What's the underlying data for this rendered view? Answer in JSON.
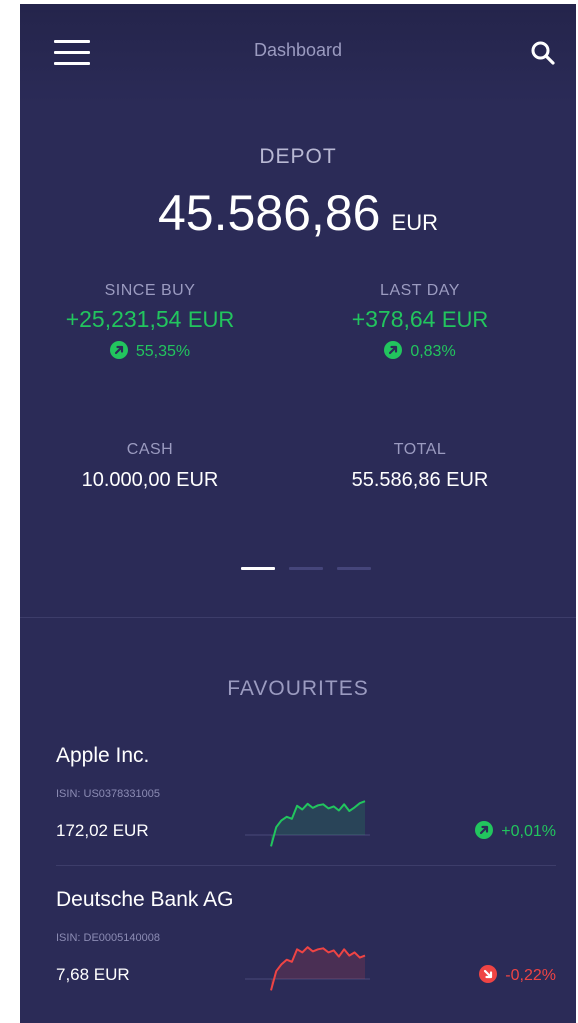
{
  "header": {
    "title": "Dashboard",
    "menu_icon": "hamburger-icon",
    "search_icon": "search-icon"
  },
  "depot": {
    "label": "DEPOT",
    "value": "45.586,86",
    "currency": "EUR"
  },
  "since_buy": {
    "label": "SINCE BUY",
    "value": "+25,231,54",
    "currency": "EUR",
    "percent": "55,35%",
    "direction": "up"
  },
  "last_day": {
    "label": "LAST DAY",
    "value": "+378,64",
    "currency": "EUR",
    "percent": "0,83%",
    "direction": "up"
  },
  "cash": {
    "label": "CASH",
    "value": "10.000,00 EUR"
  },
  "total": {
    "label": "TOTAL",
    "value": "55.586,86 EUR"
  },
  "pager": {
    "pages": 3,
    "active": 0
  },
  "favourites": {
    "title": "FAVOURITES",
    "items": [
      {
        "name": "Apple Inc.",
        "isin": "ISIN: US0378331005",
        "price": "172,02 EUR",
        "change": "+0,01%",
        "direction": "up",
        "sparkline": [
          0.05,
          0.42,
          0.55,
          0.62,
          0.58,
          0.83,
          0.76,
          0.87,
          0.79,
          0.84,
          0.86,
          0.78,
          0.82,
          0.74,
          0.86,
          0.73,
          0.8,
          0.88,
          0.92
        ]
      },
      {
        "name": "Deutsche Bank AG",
        "isin": "ISIN: DE0005140008",
        "price": "7,68 EUR",
        "change": "-0,22%",
        "direction": "down",
        "sparkline": [
          0.05,
          0.42,
          0.55,
          0.64,
          0.6,
          0.84,
          0.78,
          0.88,
          0.8,
          0.84,
          0.86,
          0.78,
          0.82,
          0.7,
          0.84,
          0.72,
          0.78,
          0.68,
          0.72
        ]
      }
    ]
  },
  "colors": {
    "background": "#2b2b57",
    "header": "#24244b",
    "positive": "#22c55e",
    "negative": "#ef4444",
    "muted_text": "#9b9bc0",
    "divider": "#3d3d6a"
  }
}
